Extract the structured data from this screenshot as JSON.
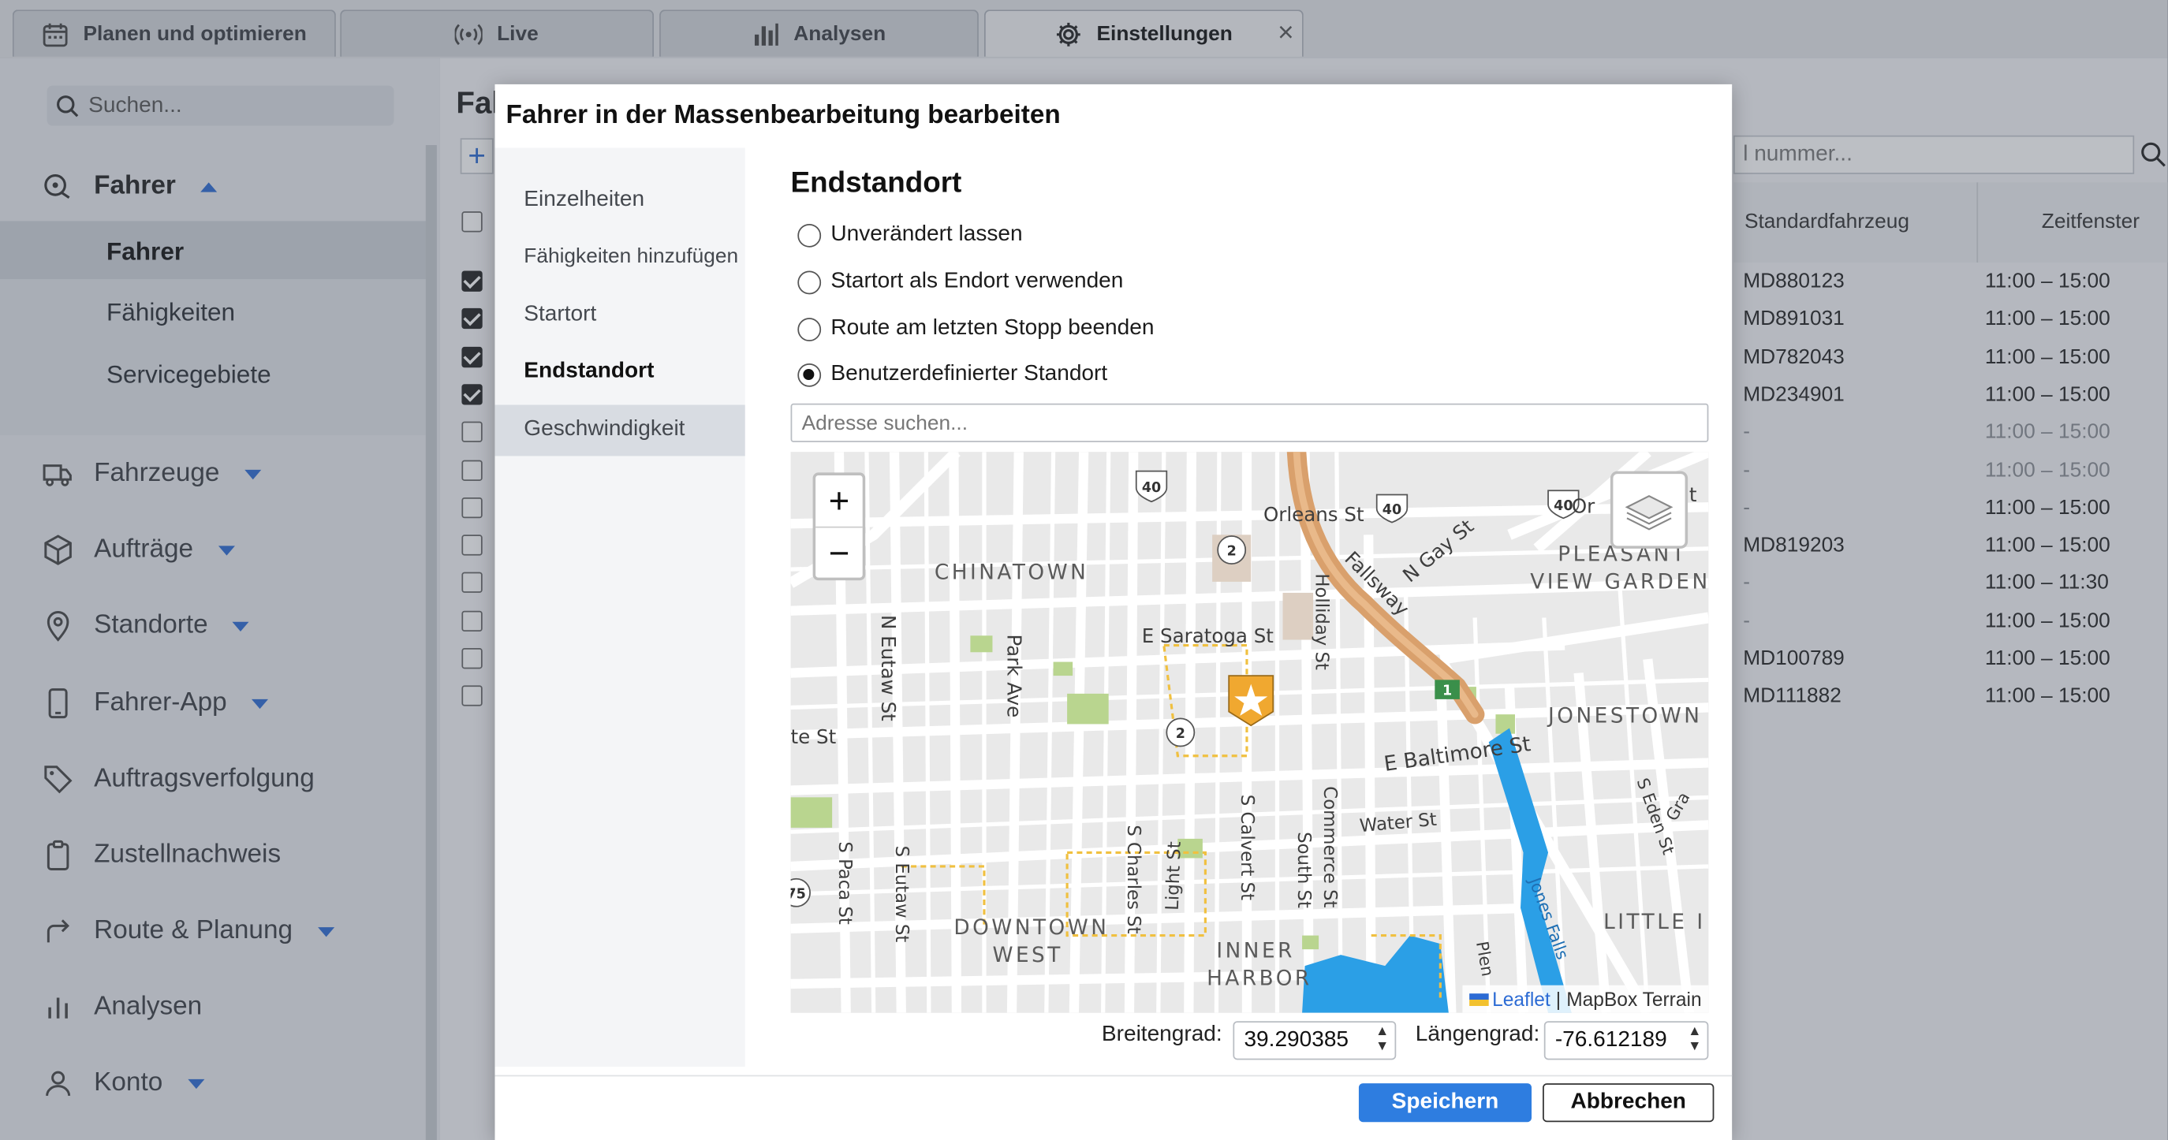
{
  "tabs": [
    {
      "label": "Planen und optimieren",
      "icon": "calendar-icon"
    },
    {
      "label": "Live",
      "icon": "broadcast-icon"
    },
    {
      "label": "Analysen",
      "icon": "bar-chart-icon"
    },
    {
      "label": "Einstellungen",
      "icon": "gear-icon",
      "active": true
    }
  ],
  "tab_close": "×",
  "sidebar": {
    "search_placeholder": "Suchen...",
    "sections": [
      {
        "label": "Fahrer",
        "icon": "driver-icon",
        "expanded": true
      },
      {
        "label": "Fahrzeuge",
        "icon": "truck-icon"
      },
      {
        "label": "Aufträge",
        "icon": "package-icon"
      },
      {
        "label": "Standorte",
        "icon": "location-pin-icon"
      },
      {
        "label": "Fahrer-App",
        "icon": "phone-icon"
      },
      {
        "label": "Auftragsverfolgung",
        "icon": "tag-icon"
      },
      {
        "label": "Zustellnachweis",
        "icon": "clipboard-icon"
      },
      {
        "label": "Route & Planung",
        "icon": "route-icon"
      },
      {
        "label": "Analysen",
        "icon": "analytics-icon"
      },
      {
        "label": "Konto",
        "icon": "user-icon"
      }
    ],
    "sub_items": [
      "Fahrer",
      "Fähigkeiten",
      "Servicegebiete"
    ]
  },
  "main": {
    "title": "Fal",
    "add_label": "+",
    "table_search_placeholder": "l nummer...",
    "columns": [
      "Standardfahrzeug",
      "Zeitfenster"
    ],
    "rows": [
      {
        "vehicle": "MD880123",
        "window": "11:00 – 15:00",
        "checked": true
      },
      {
        "vehicle": "MD891031",
        "window": "11:00 – 15:00",
        "checked": true
      },
      {
        "vehicle": "MD782043",
        "window": "11:00 – 15:00",
        "checked": true
      },
      {
        "vehicle": "MD234901",
        "window": "11:00 – 15:00",
        "checked": true
      },
      {
        "vehicle": "-",
        "window": "11:00 – 15:00",
        "checked": false
      },
      {
        "vehicle": "-",
        "window": "11:00 – 15:00",
        "checked": false
      },
      {
        "vehicle": "-",
        "window": "11:00 – 15:00",
        "checked": false
      },
      {
        "vehicle": "MD819203",
        "window": "11:00 – 15:00",
        "checked": false
      },
      {
        "vehicle": "-",
        "window": "11:00 – 11:30",
        "checked": false
      },
      {
        "vehicle": "-",
        "window": "11:00 – 15:00",
        "checked": false
      },
      {
        "vehicle": "MD100789",
        "window": "11:00 – 15:00",
        "checked": false
      },
      {
        "vehicle": "MD111882",
        "window": "11:00 – 15:00",
        "checked": false
      }
    ]
  },
  "modal": {
    "title": "Fahrer in der Massenbearbeitung bearbeiten",
    "nav": [
      "Einzelheiten",
      "Fähigkeiten hinzufügen",
      "Startort",
      "Endstandort",
      "Geschwindigkeit"
    ],
    "nav_selected": "Endstandort",
    "section_title": "Endstandort",
    "options": [
      "Unverändert lassen",
      "Startort als Endort verwenden",
      "Route am letzten Stopp beenden",
      "Benutzerdefinierter Standort"
    ],
    "selected_option": "Benutzerdefinierter Standort",
    "address_placeholder": "Adresse suchen...",
    "map": {
      "zoom_in": "+",
      "zoom_out": "−",
      "labels": {
        "chinatown": "CHINATOWN",
        "orleans": "Orleans St",
        "n_gay": "N Gay St",
        "pleasant": "PLEASANT",
        "view_gardens": "VIEW GARDENS",
        "fallsway": "Fallsway",
        "holliday": "Holliday St",
        "saratoga": "E Saratoga St",
        "n_eutaw": "N Eutaw St",
        "park_ave": "Park Ave",
        "jonestown": "JONESTOWN",
        "e_baltimore": "E Baltimore St",
        "te_st": "te St",
        "water": "Water St",
        "s_calvert": "S Calvert St",
        "commerce": "Commerce St",
        "south_st": "South St",
        "light_st": "Light St",
        "s_charles": "S Charles St",
        "s_eutaw": "S Eutaw St",
        "s_paca": "S Paca St",
        "downtown": "DOWNTOWN",
        "west": "WEST",
        "inner": "INNER",
        "harbor": "HARBOR",
        "s_eden": "S Eden St",
        "little_i": "LITTLE I",
        "jones_falls": "Jones Falls",
        "plen": "Plen",
        "gra": "Gra",
        "or": "Or",
        "t": "t",
        "shield_40": "40",
        "shield_2": "2",
        "shield_1": "1",
        "shield_75": "75"
      },
      "attribution_leaflet": "Leaflet",
      "attribution_sep": "|",
      "attribution_tiles": "MapBox Terrain",
      "colors": {
        "motorway": "#d9a06c",
        "marker": "#f0a830",
        "water": "#2b9fe6",
        "park": "#b9d58f"
      }
    },
    "latitude_label": "Breitengrad:",
    "latitude_value": "39.290385",
    "longitude_label": "Längengrad:",
    "longitude_value": "-76.612189",
    "save_label": "Speichern",
    "cancel_label": "Abbrechen",
    "accent_color": "#2e7de0"
  }
}
